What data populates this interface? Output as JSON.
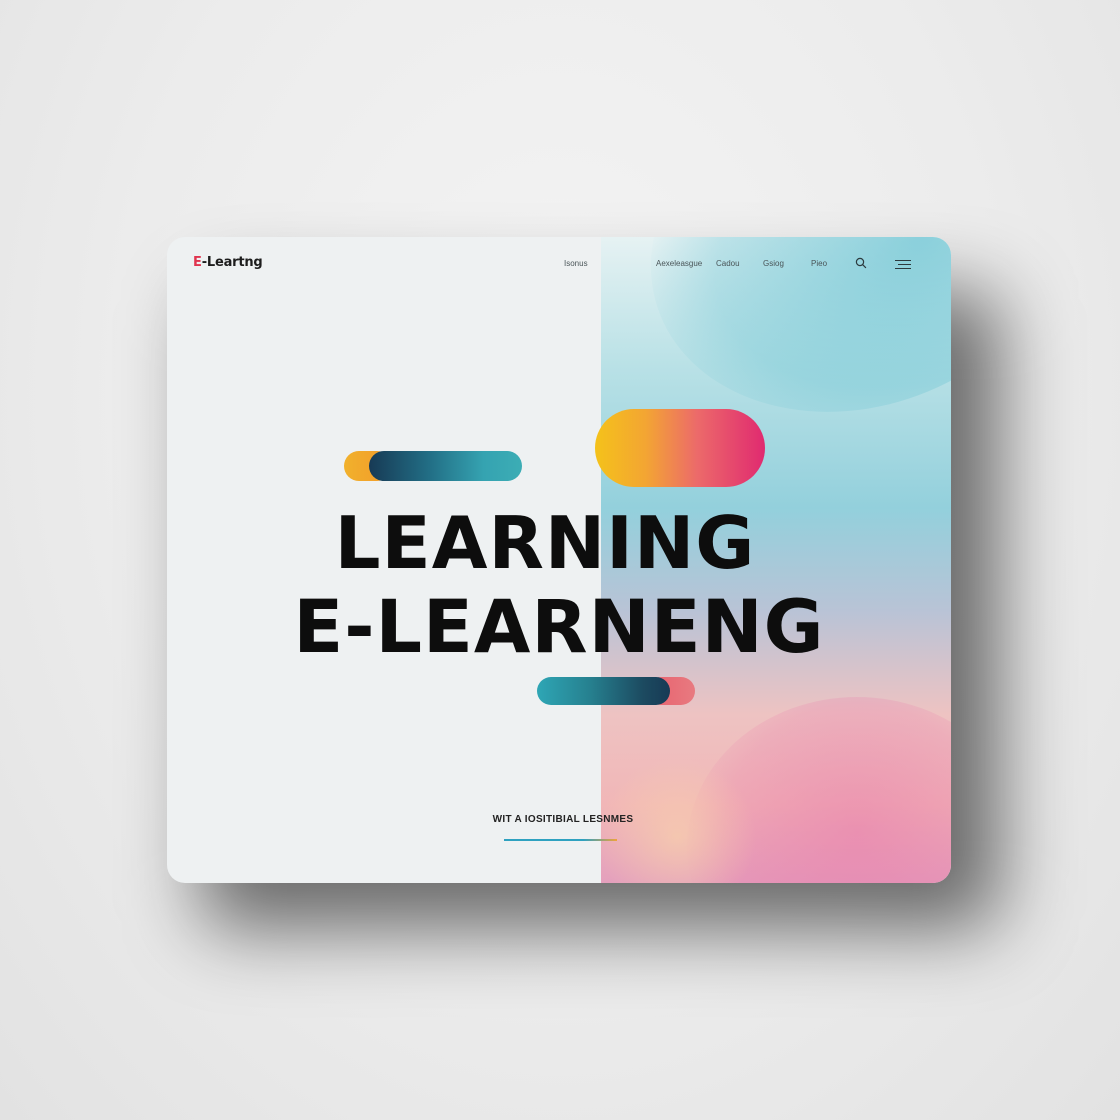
{
  "brand": {
    "logo_mark": "E",
    "logo_text": "-Leartng"
  },
  "nav": {
    "items": [
      {
        "label": "Isonus"
      },
      {
        "label": "Aexeleasgue"
      },
      {
        "label": "Cadou"
      },
      {
        "label": "Gsiog"
      },
      {
        "label": "Pieo"
      }
    ],
    "search_icon": "search-icon",
    "menu_icon": "hamburger-menu-icon"
  },
  "hero": {
    "line1": "LEARNING",
    "line2": "E-LEARNENG",
    "tagline": "WIT A IOSITIBIAL LESNMES"
  },
  "colors": {
    "accent_pink": "#e0344f",
    "accent_yellow": "#f4c21a",
    "accent_magenta": "#e02a70",
    "accent_teal": "#35a3b1",
    "accent_navy": "#173a55"
  }
}
